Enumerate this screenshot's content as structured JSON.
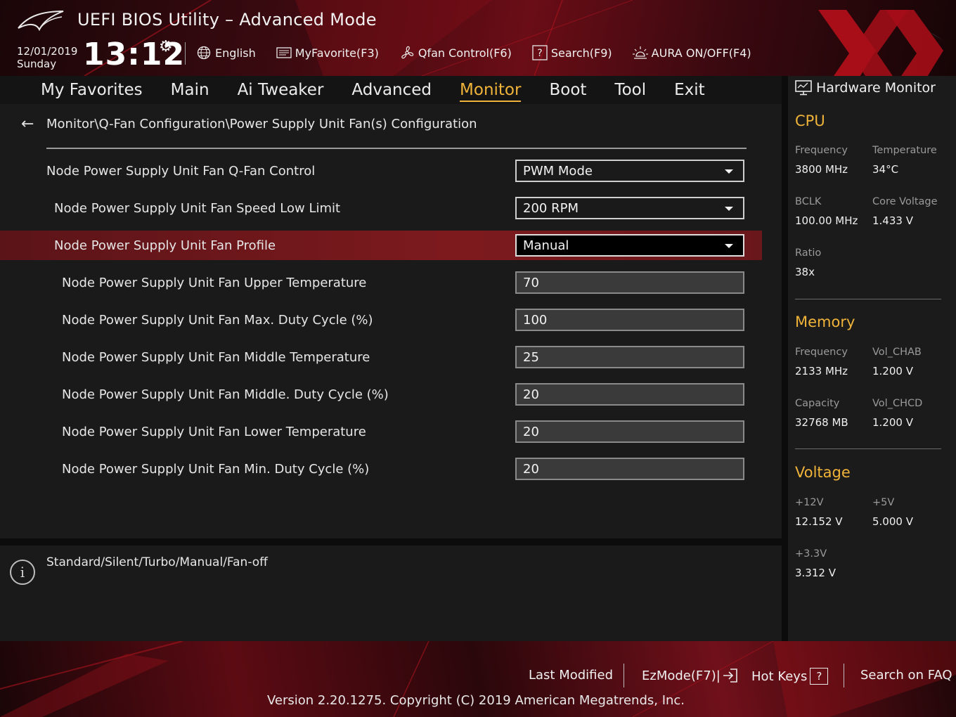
{
  "header": {
    "title": "UEFI BIOS Utility – Advanced Mode",
    "date": "12/01/2019",
    "day": "Sunday",
    "time": "13:12",
    "toolbar": [
      {
        "icon": "globe-icon",
        "label": "English"
      },
      {
        "icon": "favorite-icon",
        "label": "MyFavorite(F3)"
      },
      {
        "icon": "fan-icon",
        "label": "Qfan Control(F6)"
      },
      {
        "icon": "question-box-icon",
        "label": "Search(F9)"
      },
      {
        "icon": "aura-light-icon",
        "label": "AURA ON/OFF(F4)"
      }
    ]
  },
  "nav": {
    "tabs": [
      "My Favorites",
      "Main",
      "Ai Tweaker",
      "Advanced",
      "Monitor",
      "Boot",
      "Tool",
      "Exit"
    ],
    "active": "Monitor"
  },
  "main": {
    "breadcrumb": "Monitor\\Q-Fan Configuration\\Power Supply Unit Fan(s) Configuration",
    "settings": [
      {
        "label": "Node Power Supply Unit Fan Q-Fan Control",
        "value": "PWM Mode",
        "type": "dropdown"
      },
      {
        "label": "Node Power Supply Unit Fan Speed Low Limit",
        "value": "200 RPM",
        "type": "dropdown"
      },
      {
        "label": "Node Power Supply Unit Fan Profile",
        "value": "Manual",
        "type": "dropdown",
        "selected": true
      },
      {
        "label": "Node Power Supply Unit Fan Upper Temperature",
        "value": "70",
        "type": "field"
      },
      {
        "label": "Node Power Supply Unit Fan Max. Duty Cycle (%)",
        "value": "100",
        "type": "field"
      },
      {
        "label": "Node Power Supply Unit Fan Middle Temperature",
        "value": "25",
        "type": "field"
      },
      {
        "label": "Node Power Supply Unit Fan Middle. Duty Cycle (%)",
        "value": "20",
        "type": "field"
      },
      {
        "label": "Node Power Supply Unit Fan Lower Temperature",
        "value": "20",
        "type": "field"
      },
      {
        "label": "Node Power Supply Unit Fan Min. Duty Cycle (%)",
        "value": "20",
        "type": "field"
      }
    ]
  },
  "info": {
    "text": "Standard/Silent/Turbo/Manual/Fan-off"
  },
  "hardware_monitor": {
    "title": "Hardware Monitor",
    "cpu": {
      "heading": "CPU",
      "frequency_label": "Frequency",
      "frequency": "3800 MHz",
      "temperature_label": "Temperature",
      "temperature": "34°C",
      "bclk_label": "BCLK",
      "bclk": "100.00 MHz",
      "core_voltage_label": "Core Voltage",
      "core_voltage": "1.433 V",
      "ratio_label": "Ratio",
      "ratio": "38x"
    },
    "memory": {
      "heading": "Memory",
      "frequency_label": "Frequency",
      "frequency": "2133 MHz",
      "vol_chab_label": "Vol_CHAB",
      "vol_chab": "1.200 V",
      "capacity_label": "Capacity",
      "capacity": "32768 MB",
      "vol_chcd_label": "Vol_CHCD",
      "vol_chcd": "1.200 V"
    },
    "voltage": {
      "heading": "Voltage",
      "v12_label": "+12V",
      "v12": "12.152 V",
      "v5_label": "+5V",
      "v5": "5.000 V",
      "v33_label": "+3.3V",
      "v33": "3.312 V"
    }
  },
  "footer": {
    "last_modified": "Last Modified",
    "ezmode": "EzMode(F7)|",
    "hot_keys": "Hot Keys",
    "search_faq": "Search on FAQ",
    "version": "Version 2.20.1275. Copyright (C) 2019 American Megatrends, Inc."
  },
  "colors": {
    "accent": "#f0b33a",
    "selected_row": "#7d1a1e",
    "brand_red": "#c0141e"
  }
}
